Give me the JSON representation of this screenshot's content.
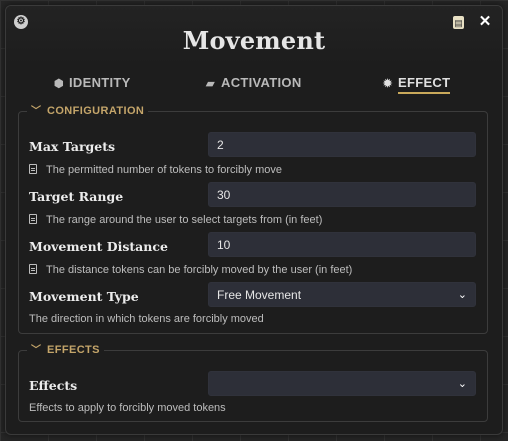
{
  "window": {
    "title": "Movement",
    "app_icon": "foundry-logo-icon",
    "sheet_icon": "sheet-icon",
    "close_label": "✕"
  },
  "tabs": [
    {
      "label": "IDENTITY",
      "icon": "tag-icon"
    },
    {
      "label": "ACTIVATION",
      "icon": "clapperboard-icon"
    },
    {
      "label": "EFFECT",
      "icon": "gear-icon",
      "active": true
    }
  ],
  "configuration": {
    "legend": "CONFIGURATION",
    "max_targets": {
      "label": "Max Targets",
      "value": "2",
      "hint": "The permitted number of tokens to forcibly move"
    },
    "target_range": {
      "label": "Target Range",
      "value": "30",
      "hint": "The range around the user to select targets from (in feet)"
    },
    "movement_distance": {
      "label": "Movement Distance",
      "value": "10",
      "hint": "The distance tokens can be forcibly moved by the user (in feet)"
    },
    "movement_type": {
      "label": "Movement Type",
      "value": "Free Movement",
      "hint": "The direction in which tokens are forcibly moved"
    }
  },
  "effects": {
    "legend": "EFFECTS",
    "effects_field": {
      "label": "Effects",
      "value": "",
      "hint": "Effects to apply to forcibly moved tokens"
    }
  },
  "colors": {
    "accent": "#c9a95b",
    "background": "#1d1d1d",
    "input": "#2d2f38"
  }
}
